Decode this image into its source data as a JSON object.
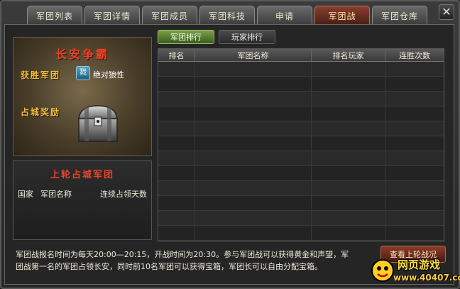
{
  "tabs": [
    {
      "label": "军团列表",
      "active": false
    },
    {
      "label": "军团详情",
      "active": false
    },
    {
      "label": "军团成员",
      "active": false
    },
    {
      "label": "军团科技",
      "active": false
    },
    {
      "label": "申请",
      "active": false
    },
    {
      "label": "军团战",
      "active": true
    },
    {
      "label": "军团仓库",
      "active": false
    }
  ],
  "close_icon": "close-icon",
  "event": {
    "title": "长安争霸",
    "winner_label": "获胜军团",
    "winner_emblem": "戮",
    "winner_name": "绝对狼性",
    "reward_label": "占城奖励",
    "reward_icon": "treasure-chest-icon"
  },
  "last_occupier": {
    "title": "上轮占城军团",
    "headers": [
      "国家",
      "军团名称",
      "连续占领天数"
    ]
  },
  "subtabs": [
    {
      "label": "军团排行",
      "active": true
    },
    {
      "label": "玩家排行",
      "active": false
    }
  ],
  "ranking_table": {
    "headers": [
      "排名",
      "军团名称",
      "排名玩家",
      "连胜次数"
    ],
    "rows": [
      [],
      [],
      [],
      [],
      [],
      [],
      [],
      [],
      [],
      [],
      [],
      []
    ]
  },
  "info": {
    "line1": "军团战报名时间为每天20:00—20:15，开战时间为20:30。参与军团战可以获得黄金和声望，军",
    "line2": "团战第一名的军团占领长安，同时前10名军团可以获得宝箱，军团长可以自由分配宝箱。"
  },
  "view_button": "查看上轮战况",
  "watermark": {
    "name": "网页游戏",
    "url": "www.40407.com"
  }
}
